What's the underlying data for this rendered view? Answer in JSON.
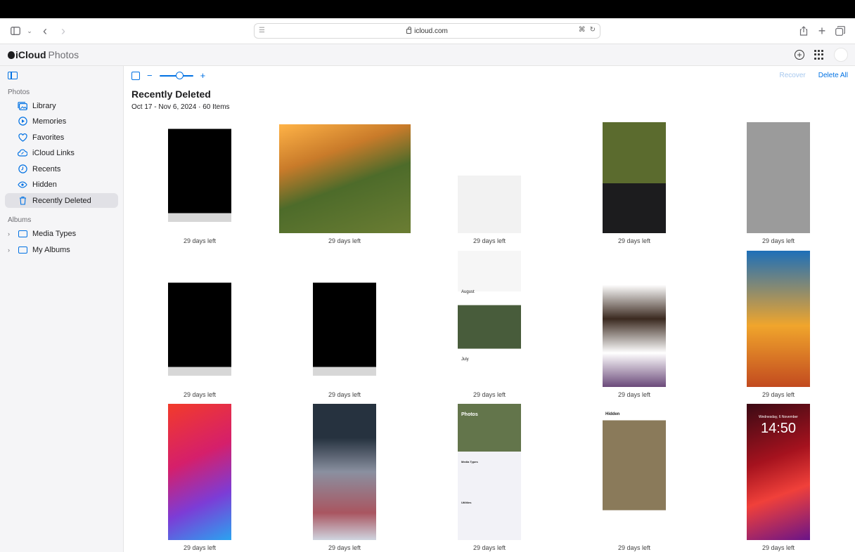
{
  "browser": {
    "address": "icloud.com"
  },
  "app": {
    "brand_bold": "iCloud",
    "brand_light": "Photos"
  },
  "sidebar": {
    "photos_section": "Photos",
    "items": [
      {
        "label": "Library",
        "icon": "library-icon"
      },
      {
        "label": "Memories",
        "icon": "memories-icon"
      },
      {
        "label": "Favorites",
        "icon": "heart-icon"
      },
      {
        "label": "iCloud Links",
        "icon": "cloud-link-icon"
      },
      {
        "label": "Recents",
        "icon": "clock-icon"
      },
      {
        "label": "Hidden",
        "icon": "eye-icon"
      },
      {
        "label": "Recently Deleted",
        "icon": "trash-icon"
      }
    ],
    "albums_section": "Albums",
    "albums": [
      {
        "label": "Media Types",
        "icon": "folder-icon"
      },
      {
        "label": "My Albums",
        "icon": "folder-icon"
      }
    ]
  },
  "toolbar": {
    "zoom_level": 0.6,
    "recover_label": "Recover",
    "delete_all_label": "Delete All"
  },
  "header": {
    "title": "Recently Deleted",
    "date_range": "Oct 17 - Nov 6, 2024",
    "separator": "·",
    "count": "60 Items"
  },
  "photos": [
    {
      "caption": "29 days left",
      "thumb": "phone-black"
    },
    {
      "caption": "29 days left",
      "thumb": "landscape-collage"
    },
    {
      "caption": "29 days left",
      "thumb": "mosaic-share"
    },
    {
      "caption": "29 days left",
      "thumb": "collage-editor"
    },
    {
      "caption": "29 days left",
      "thumb": "grey-screen"
    },
    {
      "caption": "29 days left",
      "thumb": "phone-black"
    },
    {
      "caption": "29 days left",
      "thumb": "phone-black"
    },
    {
      "caption": "29 days left",
      "thumb": "google-photos",
      "text_a": "August",
      "text_b": "July"
    },
    {
      "caption": "29 days left",
      "thumb": "picsart"
    },
    {
      "caption": "29 days left",
      "thumb": "game"
    },
    {
      "caption": "29 days left",
      "thumb": "home-screen"
    },
    {
      "caption": "29 days left",
      "thumb": "blur"
    },
    {
      "caption": "29 days left",
      "thumb": "photos-settings",
      "text_a": "Photos",
      "text_b": "Media Types",
      "text_c": "Utilities"
    },
    {
      "caption": "29 days left",
      "thumb": "hidden-album",
      "text_a": "Hidden"
    },
    {
      "caption": "29 days left",
      "thumb": "lock-screen",
      "text_a": "14:50",
      "text_b": "Wednesday, 6 November"
    }
  ]
}
